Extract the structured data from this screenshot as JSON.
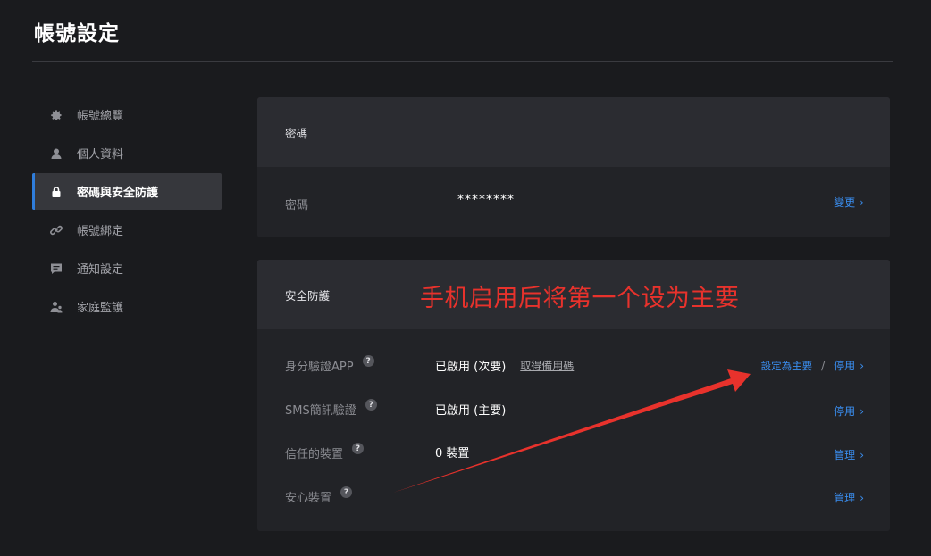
{
  "page": {
    "title": "帳號設定"
  },
  "sidebar": {
    "items": [
      {
        "label": "帳號總覽",
        "icon": "gear-icon",
        "active": false
      },
      {
        "label": "個人資料",
        "icon": "user-icon",
        "active": false
      },
      {
        "label": "密碼與安全防護",
        "icon": "lock-icon",
        "active": true
      },
      {
        "label": "帳號綁定",
        "icon": "link-icon",
        "active": false
      },
      {
        "label": "通知設定",
        "icon": "message-icon",
        "active": false
      },
      {
        "label": "家庭監護",
        "icon": "family-icon",
        "active": false
      }
    ]
  },
  "password_card": {
    "header": "密碼",
    "row": {
      "label": "密碼",
      "value": "********",
      "action": "變更"
    }
  },
  "security_card": {
    "header": "安全防護",
    "rows": [
      {
        "label": "身分驗證APP",
        "help": "?",
        "value": "已啟用 (次要)",
        "extra_link": "取得備用碼",
        "action_primary": "設定為主要",
        "separator": "/",
        "action": "停用"
      },
      {
        "label": "SMS簡訊驗證",
        "help": "?",
        "value": "已啟用 (主要)",
        "action": "停用"
      },
      {
        "label": "信任的裝置",
        "help": "?",
        "value": "0 裝置",
        "action": "管理"
      },
      {
        "label": "安心裝置",
        "help": "?",
        "value": "",
        "action": "管理"
      }
    ]
  },
  "annotation": {
    "text": "手机启用后将第一个设为主要",
    "color": "#e8322c"
  },
  "colors": {
    "accent": "#2f7ddb",
    "link": "#3a8ef0",
    "background": "#1a1b1e",
    "card": "#222327",
    "card_header": "#2b2c31"
  }
}
